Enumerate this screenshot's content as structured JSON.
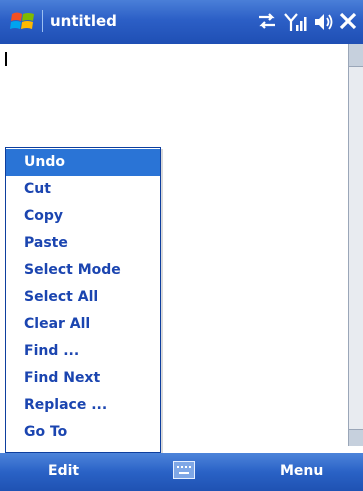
{
  "window": {
    "title": "untitled"
  },
  "status_icons": [
    "connectivity-icon",
    "signal-icon",
    "speaker-icon",
    "close-icon"
  ],
  "context_menu": {
    "items": [
      {
        "label": "Undo",
        "selected": true
      },
      {
        "label": "Cut",
        "selected": false
      },
      {
        "label": "Copy",
        "selected": false
      },
      {
        "label": "Paste",
        "selected": false
      },
      {
        "label": "Select Mode",
        "selected": false
      },
      {
        "label": "Select All",
        "selected": false
      },
      {
        "label": "Clear All",
        "selected": false
      },
      {
        "label": "Find ...",
        "selected": false
      },
      {
        "label": "Find Next",
        "selected": false
      },
      {
        "label": "Replace ...",
        "selected": false
      },
      {
        "label": "Go To",
        "selected": false
      }
    ]
  },
  "softkeys": {
    "left": "Edit",
    "right": "Menu"
  },
  "colors": {
    "titlebar": "#2c5fc6",
    "menu_text": "#1b45b0",
    "menu_highlight": "#2a74d6"
  }
}
